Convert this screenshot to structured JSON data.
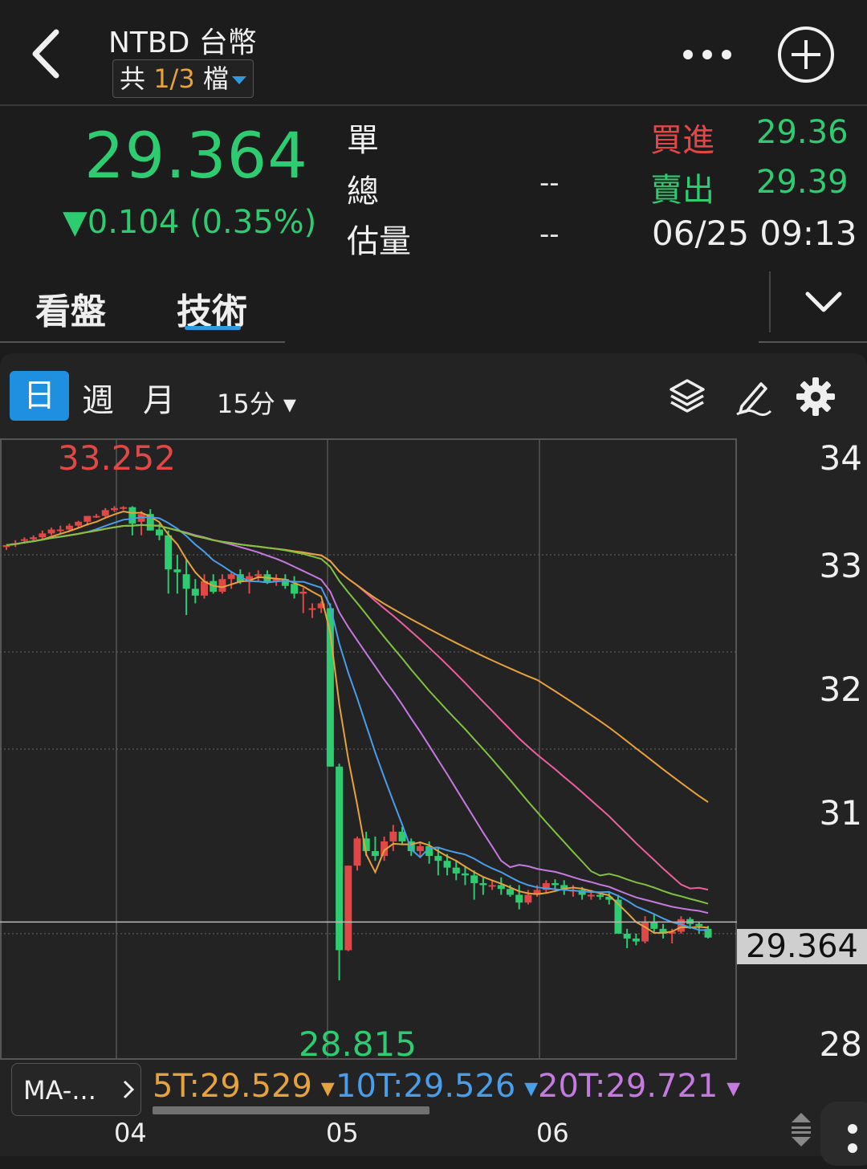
{
  "header": {
    "title": "NTBD 台幣",
    "count_prefix": "共 ",
    "count_value": "1/3",
    "count_suffix": " 檔"
  },
  "quote": {
    "price": "29.364",
    "change": "0.104 (0.35%)",
    "labels": {
      "single": "單",
      "total": "總",
      "estimate": "估量"
    },
    "total_value": "--",
    "estimate_value": "--",
    "bid_label": "買進",
    "bid_value": "29.36",
    "ask_label": "賣出",
    "ask_value": "29.39",
    "time": "06/25 09:13",
    "colors": {
      "up": "#e04848",
      "down": "#2ecc71"
    }
  },
  "tabs": [
    {
      "label": "看盤"
    },
    {
      "label": "技術",
      "active": true
    }
  ],
  "periods": [
    {
      "label": "日",
      "active": true
    },
    {
      "label": "週"
    },
    {
      "label": "月"
    }
  ],
  "interval": "15分 ▾",
  "tools": [
    "layers-icon",
    "pencil-icon",
    "gear-icon"
  ],
  "chart_data": {
    "type": "candlestick",
    "ylim": [
      27.8,
      34.3
    ],
    "yticks": [
      "34",
      "33",
      "32",
      "31",
      "28"
    ],
    "xticks": [
      "04",
      "05",
      "06"
    ],
    "high_label": "33.252",
    "low_label": "28.815",
    "current_price": "29.364",
    "candles": [
      [
        33.08,
        33.1,
        33.05,
        33.1
      ],
      [
        33.12,
        33.15,
        33.08,
        33.12
      ],
      [
        33.15,
        33.18,
        33.12,
        33.16
      ],
      [
        33.16,
        33.2,
        33.14,
        33.18
      ],
      [
        33.18,
        33.25,
        33.16,
        33.22
      ],
      [
        33.22,
        33.28,
        33.2,
        33.26
      ],
      [
        33.26,
        33.3,
        33.22,
        33.26
      ],
      [
        33.26,
        33.32,
        33.25,
        33.3
      ],
      [
        33.3,
        33.35,
        33.28,
        33.34
      ],
      [
        33.34,
        33.38,
        33.3,
        33.4
      ],
      [
        33.4,
        33.42,
        33.38,
        33.4
      ],
      [
        33.4,
        33.48,
        33.38,
        33.46
      ],
      [
        33.46,
        33.5,
        33.44,
        33.48
      ],
      [
        33.48,
        33.5,
        33.46,
        33.49
      ],
      [
        33.49,
        33.5,
        33.2,
        33.32
      ],
      [
        33.34,
        33.45,
        33.2,
        33.42
      ],
      [
        33.42,
        33.47,
        33.25,
        33.25
      ],
      [
        33.26,
        33.32,
        33.15,
        33.2
      ],
      [
        33.2,
        33.25,
        32.6,
        32.85
      ],
      [
        32.85,
        33.0,
        32.6,
        32.82
      ],
      [
        32.8,
        32.95,
        32.38,
        32.65
      ],
      [
        32.65,
        32.75,
        32.5,
        32.58
      ],
      [
        32.58,
        32.8,
        32.55,
        32.73
      ],
      [
        32.73,
        32.8,
        32.6,
        32.62
      ],
      [
        32.62,
        32.8,
        32.6,
        32.75
      ],
      [
        32.75,
        32.82,
        32.65,
        32.8
      ],
      [
        32.8,
        32.85,
        32.7,
        32.72
      ],
      [
        32.72,
        32.82,
        32.6,
        32.78
      ],
      [
        32.78,
        32.84,
        32.72,
        32.8
      ],
      [
        32.8,
        32.84,
        32.7,
        32.72
      ],
      [
        32.72,
        32.8,
        32.68,
        32.75
      ],
      [
        32.75,
        32.8,
        32.65,
        32.68
      ],
      [
        32.7,
        32.78,
        32.55,
        32.6
      ],
      [
        32.6,
        32.66,
        32.4,
        32.62
      ],
      [
        32.45,
        32.5,
        32.35,
        32.45
      ],
      [
        32.45,
        32.52,
        32.4,
        32.5
      ],
      [
        32.45,
        32.5,
        30.82,
        30.82
      ],
      [
        30.82,
        30.85,
        28.62,
        28.93
      ],
      [
        28.93,
        29.8,
        28.92,
        29.8
      ],
      [
        29.8,
        30.1,
        29.75,
        30.08
      ],
      [
        30.08,
        30.15,
        29.9,
        29.95
      ],
      [
        29.95,
        30.1,
        29.85,
        29.9
      ],
      [
        29.9,
        30.1,
        29.85,
        30.05
      ],
      [
        30.05,
        30.22,
        29.95,
        30.15
      ],
      [
        30.15,
        30.2,
        30.02,
        30.05
      ],
      [
        30.05,
        30.08,
        29.9,
        29.95
      ],
      [
        29.95,
        30.05,
        29.88,
        30.0
      ],
      [
        30.0,
        30.05,
        29.82,
        29.9
      ],
      [
        29.9,
        29.98,
        29.7,
        29.85
      ],
      [
        29.85,
        29.92,
        29.7,
        29.78
      ],
      [
        29.78,
        29.85,
        29.65,
        29.72
      ],
      [
        29.72,
        29.8,
        29.6,
        29.7
      ],
      [
        29.7,
        29.75,
        29.45,
        29.62
      ],
      [
        29.62,
        29.68,
        29.5,
        29.6
      ],
      [
        29.6,
        29.65,
        29.55,
        29.6
      ],
      [
        29.6,
        29.68,
        29.5,
        29.56
      ],
      [
        29.56,
        29.6,
        29.48,
        29.5
      ],
      [
        29.5,
        29.6,
        29.35,
        29.42
      ],
      [
        29.42,
        29.55,
        29.4,
        29.5
      ],
      [
        29.5,
        29.6,
        29.48,
        29.55
      ],
      [
        29.55,
        29.65,
        29.52,
        29.62
      ],
      [
        29.62,
        29.66,
        29.55,
        29.6
      ],
      [
        29.6,
        29.65,
        29.5,
        29.55
      ],
      [
        29.55,
        29.6,
        29.48,
        29.55
      ],
      [
        29.55,
        29.58,
        29.45,
        29.5
      ],
      [
        29.5,
        29.55,
        29.45,
        29.5
      ],
      [
        29.5,
        29.52,
        29.45,
        29.48
      ],
      [
        29.48,
        29.52,
        29.4,
        29.45
      ],
      [
        29.45,
        29.5,
        29.15,
        29.1
      ],
      [
        29.1,
        29.15,
        28.95,
        29.05
      ],
      [
        29.05,
        29.1,
        28.98,
        29.02
      ],
      [
        29.02,
        29.28,
        29.0,
        29.22
      ],
      [
        29.22,
        29.3,
        29.1,
        29.15
      ],
      [
        29.15,
        29.2,
        29.05,
        29.1
      ],
      [
        29.1,
        29.15,
        29.0,
        29.12
      ],
      [
        29.12,
        29.28,
        29.1,
        29.25
      ],
      [
        29.25,
        29.27,
        29.15,
        29.2
      ],
      [
        29.2,
        29.22,
        29.1,
        29.18
      ],
      [
        29.15,
        29.18,
        29.05,
        29.06
      ]
    ],
    "series": [
      {
        "name": "5T",
        "color": "#e6a23c"
      },
      {
        "name": "10T",
        "color": "#4a9de8"
      },
      {
        "name": "20T",
        "color": "#c57ae0"
      },
      {
        "color": "#ef5fa0"
      },
      {
        "color": "#e6a23c"
      },
      {
        "color": "#7fc241"
      }
    ]
  },
  "ma_bar": {
    "button_label": "MA-...",
    "values": [
      {
        "text": "5T:29.529",
        "color": "#e6a23c"
      },
      {
        "text": "10T:29.526",
        "color": "#4a9de8"
      },
      {
        "text": "20T:29.721",
        "color": "#c57ae0"
      }
    ]
  }
}
